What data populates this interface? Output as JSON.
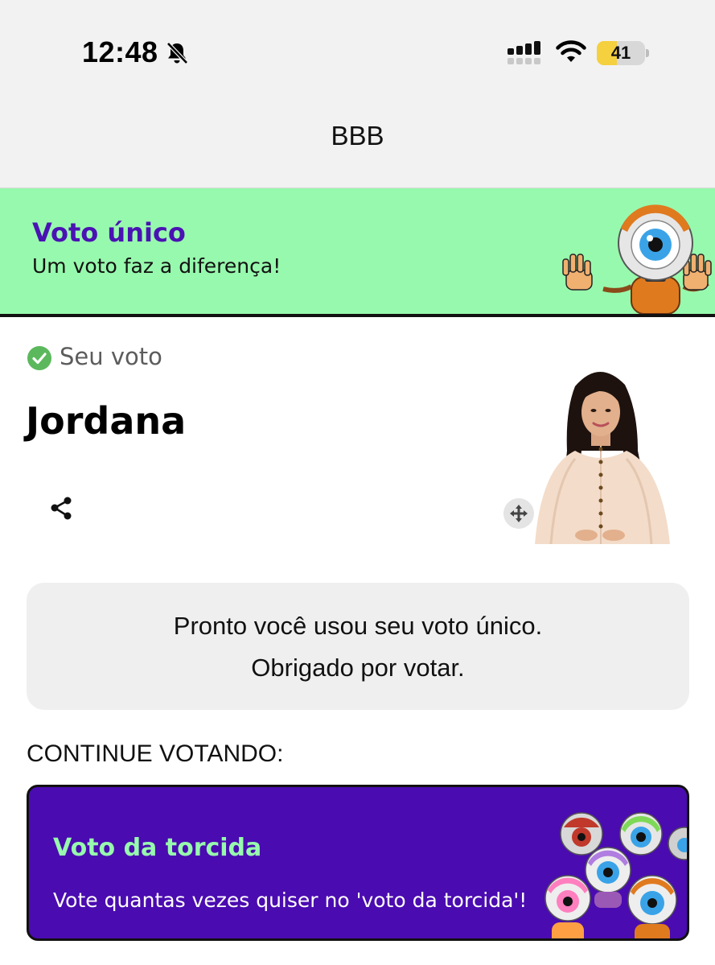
{
  "status_bar": {
    "time": "12:48",
    "battery_percent": "41",
    "battery_level": 0.41,
    "icons": [
      "bell-slash-icon",
      "cellular-signal-icon",
      "wifi-icon",
      "battery-icon"
    ]
  },
  "nav": {
    "title": "BBB"
  },
  "banner": {
    "title": "Voto único",
    "subtitle": "Um voto faz a diferença!"
  },
  "vote": {
    "status_label": "Seu voto",
    "candidate_name": "Jordana"
  },
  "confirmation": {
    "line1": "Pronto você usou seu voto único.",
    "line2": "Obrigado por votar."
  },
  "continue_label": "CONTINUE VOTANDO:",
  "torcida_card": {
    "title": "Voto da torcida",
    "subtitle": "Vote quantas vezes quiser no 'voto da torcida'!"
  },
  "colors": {
    "banner_bg": "#97f9ad",
    "brand_purple": "#4a12b3",
    "card_bg": "#4a0bb0",
    "check_green": "#5cb85c",
    "battery_fill": "#f5d03f"
  }
}
